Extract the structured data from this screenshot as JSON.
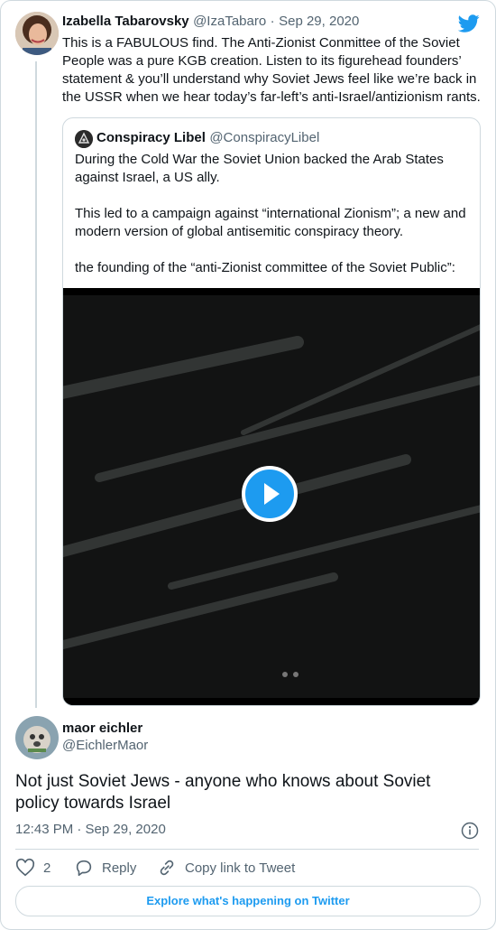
{
  "original": {
    "name": "Izabella Tabarovsky",
    "handle": "@IzaTabaro",
    "date_sep": "·",
    "date": "Sep 29, 2020",
    "text_lines": [
      "This is a FABULOUS find. The Anti-Zionist Conmittee of the Soviet",
      "People was a pure KGB creation. Listen to its figurehead founders’",
      "statement & you’ll understand why Soviet Jews feel like we’re back in",
      "the USSR when we hear today’s far-left’s anti-Israel/antizionism rants."
    ]
  },
  "quoted": {
    "name": "Conspiracy Libel",
    "handle": "@ConspiracyLibel",
    "text_lines": [
      "During the Cold War the Soviet Union backed the Arab States",
      "against Israel, a US ally.",
      "",
      "This led to a campaign against “international Zionism”; a new and",
      "modern version of global antisemitic conspiracy theory.",
      "",
      "the founding of the “anti-Zionist committee of the Soviet Public”:"
    ]
  },
  "reply": {
    "name": "maor eichler",
    "handle": "@EichlerMaor",
    "text_lines": [
      "Not just Soviet Jews - anyone who knows about Soviet",
      "policy towards Israel"
    ],
    "time": "12:43 PM · Sep 29, 2020"
  },
  "actions": {
    "like_count": "2",
    "reply_label": "Reply",
    "copy_label": "Copy link to Tweet"
  },
  "explore_label": "Explore what's happening on Twitter",
  "colors": {
    "twitter_blue": "#1d9bf0",
    "text_secondary": "#536471",
    "border": "#cfd9de"
  },
  "icons": [
    "twitter-bird-icon",
    "play-icon",
    "info-icon",
    "heart-icon",
    "reply-bubble-icon",
    "link-icon"
  ]
}
